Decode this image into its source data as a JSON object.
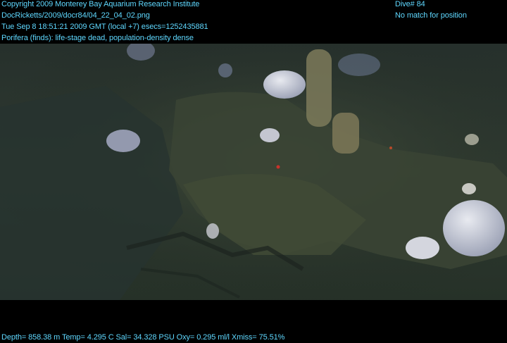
{
  "overlay": {
    "copyright": "Copyright 2009 Monterey Bay Aquarium Research Institute",
    "file_path": "DocRicketts/2009/docr84/04_22_04_02.png",
    "timestamp": "Tue Sep  8 18:51:21 2009 GMT (local +7)  esecs=1252435881",
    "annotation": "Porifera (finds): life-stage dead, population-density dense",
    "dive": "Dive# 84",
    "position_status": "No match for position",
    "telemetry": "Depth= 858.38 m  Temp= 4.295 C  Sal= 34.328 PSU  Oxy= 0.295 ml/l  Xmiss= 75.51%"
  },
  "colors": {
    "overlay_text": "#5fd8ff",
    "frame_background": "#000000",
    "seafloor": "#2f3c31",
    "sponge": "#c9ccd6"
  }
}
